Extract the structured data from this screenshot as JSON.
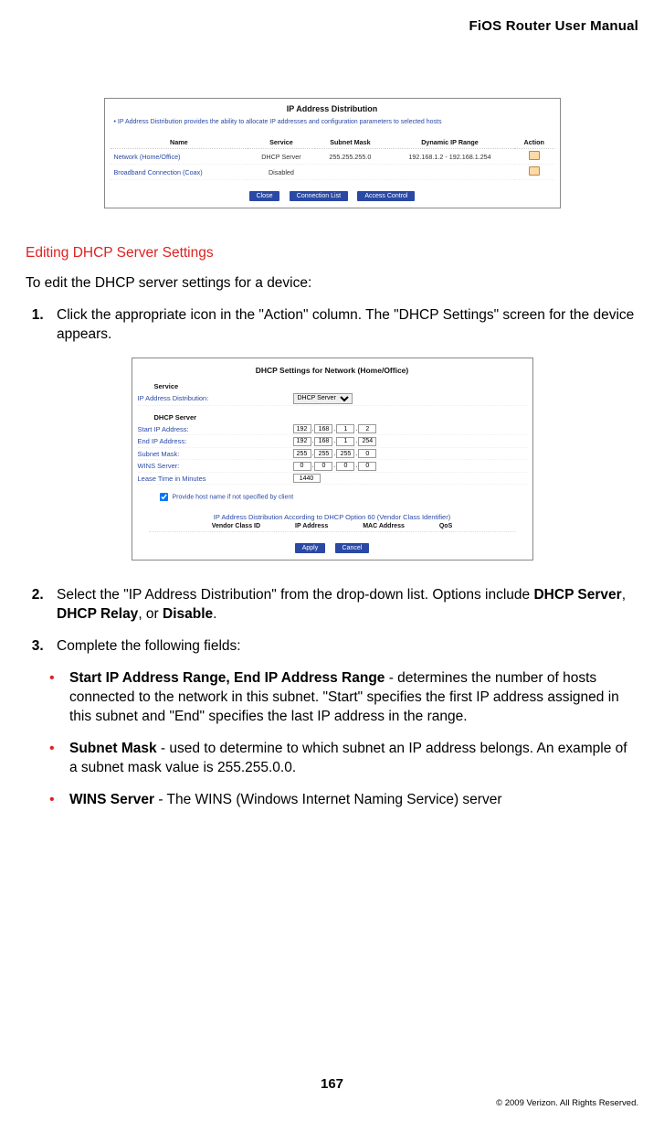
{
  "header": {
    "title": "FiOS Router User Manual"
  },
  "ss1": {
    "title": "IP Address Distribution",
    "note": "•  IP Address Distribution provides the ability to allocate IP addresses and configuration parameters to selected hosts",
    "cols": [
      "Name",
      "Service",
      "Subnet Mask",
      "Dynamic IP Range",
      "Action"
    ],
    "rows": [
      {
        "name": "Network (Home/Office)",
        "service": "DHCP Server",
        "mask": "255.255.255.0",
        "range": "192.168.1.2 - 192.168.1.254"
      },
      {
        "name": "Broadband Connection (Coax)",
        "service": "Disabled",
        "mask": "",
        "range": ""
      }
    ],
    "buttons": [
      "Close",
      "Connection List",
      "Access Control"
    ]
  },
  "section": {
    "title": "Editing DHCP Server Settings"
  },
  "intro": "To edit the DHCP server settings for a device:",
  "step1": "Click the appropriate icon in the \"Action\" column. The \"DHCP Settings\" screen for the device appears.",
  "ss2": {
    "title": "DHCP Settings for Network (Home/Office)",
    "service_head": "Service",
    "ip_dist_label": "IP Address Distribution:",
    "ip_dist_value": "DHCP Server",
    "server_head": "DHCP Server",
    "start_label": "Start IP Address:",
    "end_label": "End IP Address:",
    "mask_label": "Subnet Mask:",
    "wins_label": "WINS Server:",
    "lease_label": "Lease Time in Minutes",
    "start": [
      "192",
      "168",
      "1",
      "2"
    ],
    "end": [
      "192",
      "168",
      "1",
      "254"
    ],
    "mask": [
      "255",
      "255",
      "255",
      "0"
    ],
    "wins": [
      "0",
      "0",
      "0",
      "0"
    ],
    "lease": "1440",
    "checkbox": "Provide host name if not specified by client",
    "subtitle": "IP Address Distribution According to DHCP Option 60 (Vendor Class Identifier)",
    "subcols": [
      "Vendor Class ID",
      "IP Address",
      "MAC Address",
      "QoS"
    ],
    "buttons": [
      "Apply",
      "Cancel"
    ]
  },
  "step2_a": "Select the \"IP Address Distribution\" from the drop-down list. Options include ",
  "step2_b1": "DHCP Server",
  "step2_b2": "DHCP Relay",
  "step2_b3": "Disable",
  "step2_c1": ", ",
  "step2_c2": ", or ",
  "step2_c3": ".",
  "step3": "Complete the following fields:",
  "bullets": {
    "b1_bold": "Start IP Address Range, End IP Address Range",
    "b1_rest": " - determines the number of hosts connected to the network in this subnet. \"Start\" specifies the first IP address assigned in this subnet and \"End\" specifies the last IP address in the range.",
    "b2_bold": "Subnet Mask",
    "b2_rest": " - used to determine to which subnet an IP address belongs. An example of a subnet mask value is 255.255.0.0.",
    "b3_bold": "WINS  Server",
    "b3_rest": " - The WINS (Windows Internet Naming Service) server"
  },
  "page_num": "167",
  "copyright": "© 2009 Verizon. All Rights Reserved."
}
